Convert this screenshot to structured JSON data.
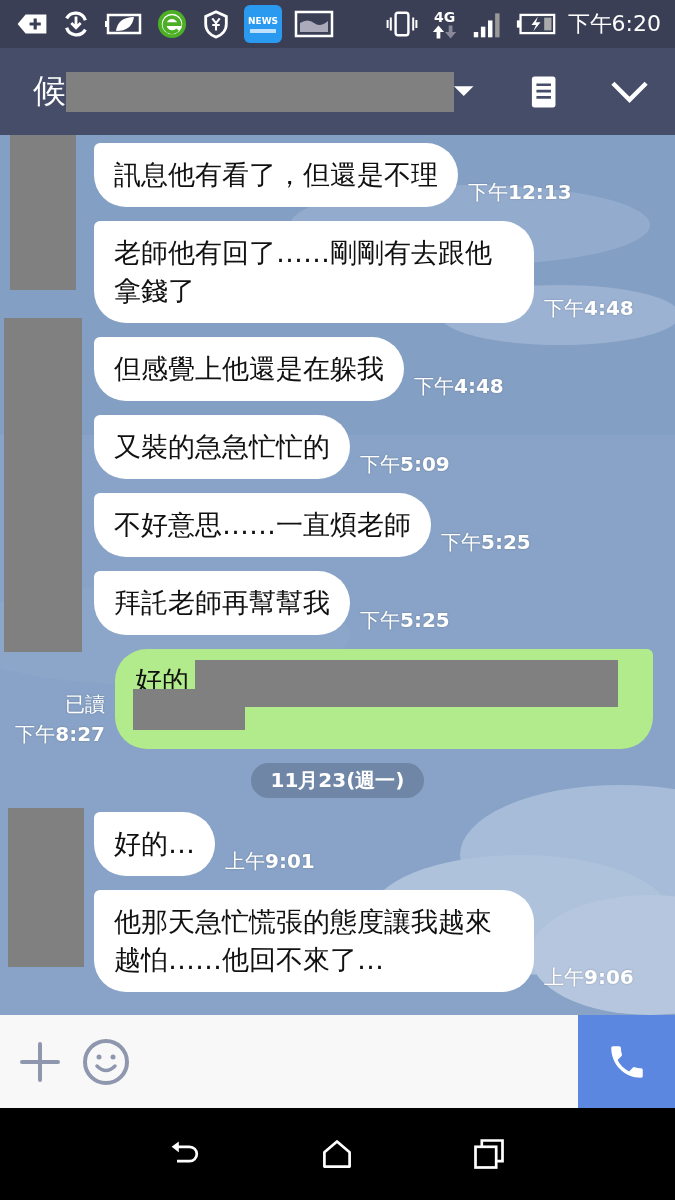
{
  "status_bar": {
    "news_label": "NEWS",
    "network": "4G",
    "time": "下午6:20"
  },
  "header": {
    "title": "候",
    "title_redacted": true
  },
  "chat": [
    {
      "kind": "group",
      "avatar_redacted": true,
      "messages": [
        {
          "text": "訊息他有看了，但還是不理",
          "time": "下午**12:13**"
        },
        {
          "text": "老師他有回了……剛剛有去跟他拿錢了",
          "time": "下午**4:48**"
        }
      ]
    },
    {
      "kind": "group",
      "avatar_redacted": true,
      "messages": [
        {
          "text": "但感覺上他還是在躲我",
          "time": "下午**4:48**"
        },
        {
          "text": "又裝的急急忙忙的",
          "time": "下午**5:09**"
        },
        {
          "text": "不好意思……一直煩老師",
          "time": "下午**5:25**"
        },
        {
          "text": "拜託老師再幫幫我",
          "time": "下午**5:25**"
        }
      ]
    },
    {
      "kind": "outgoing",
      "text": "好的",
      "redacted": true,
      "read": "已讀",
      "time": "下午**8:27**"
    },
    {
      "kind": "date",
      "text": "11月23(週一)"
    },
    {
      "kind": "group",
      "avatar_redacted": true,
      "messages": [
        {
          "text": "好的…",
          "time": "上午**9:01**"
        },
        {
          "text": "他那天急忙慌張的態度讓我越來越怕……他回不來了…",
          "time": "上午**9:06**"
        }
      ]
    }
  ]
}
